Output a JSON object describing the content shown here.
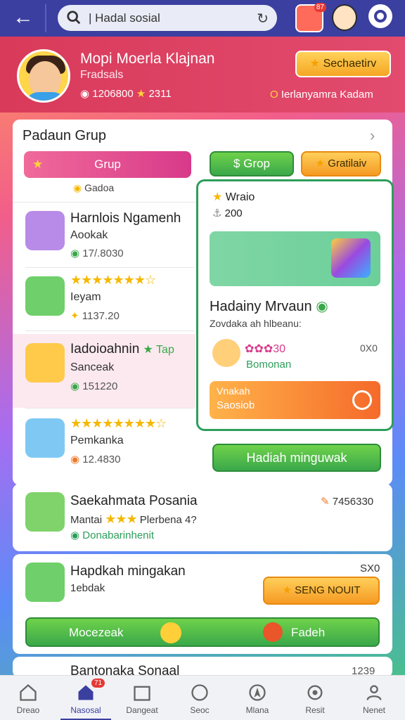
{
  "topbar": {
    "search_text": "| Hadal sosial",
    "game_badge": "87"
  },
  "profile": {
    "name": "Mopi Moerla Klajnan",
    "subtitle": "Fradsals",
    "stats": "1206800",
    "stats2": "2311",
    "button": "Sechaetirv",
    "note": "Ierlanyamra Kadam"
  },
  "group": {
    "title": "Padaun Grup",
    "grup_label": "Grup",
    "group_label": "$ Grop",
    "gratuit_label": "Gratilaiv",
    "sub": "Gadoa"
  },
  "list": [
    {
      "name": "Harnlois Ngamenh",
      "sub": "Aookak",
      "num": "17/.8030"
    },
    {
      "name": "",
      "sub": "Ieyam",
      "num": "1137.20"
    },
    {
      "name": "Iadoioahnin",
      "tag": "Tap",
      "sub": "Sanceak",
      "num": "151220"
    },
    {
      "name": "",
      "sub": "Pemkanka",
      "num": "12.4830"
    }
  ],
  "popup": {
    "title": "Wraio",
    "num": "200",
    "heading": "Hadainy Mrvaun",
    "sub": "Zovdaka ah hlbeanu:",
    "stars_text": "✿✿✿30",
    "value": "0X0",
    "name": "Bomonan",
    "cta_line1": "Vnakah",
    "cta_line2": "Saosiob"
  },
  "hadiah_button": "Hadiah minguwak",
  "entry1": {
    "name": "Saekahmata Posania",
    "left": "Mantai",
    "right": "Plerbena 4?",
    "sub": "Donabarinhenit",
    "value": "7456330"
  },
  "entry2": {
    "name": "Hapdkah mingakan",
    "sub": "1ebdak",
    "value": "SX0",
    "button": "SENG NOUIT",
    "bar_left": "Mocezeak",
    "bar_right": "Fadeh"
  },
  "entry3": {
    "name": "Bantonaka Sonaal",
    "value": "1239"
  },
  "nav": [
    {
      "label": "Dreao",
      "icon": "home-icon"
    },
    {
      "label": "Nasosal",
      "icon": "social-home-icon",
      "badge": "71"
    },
    {
      "label": "Dangeat",
      "icon": "calendar-icon"
    },
    {
      "label": "Seoc",
      "icon": "chat-icon"
    },
    {
      "label": "Mlana",
      "icon": "map-icon"
    },
    {
      "label": "Resit",
      "icon": "gear-icon"
    },
    {
      "label": "Nenet",
      "icon": "profile-icon"
    }
  ]
}
